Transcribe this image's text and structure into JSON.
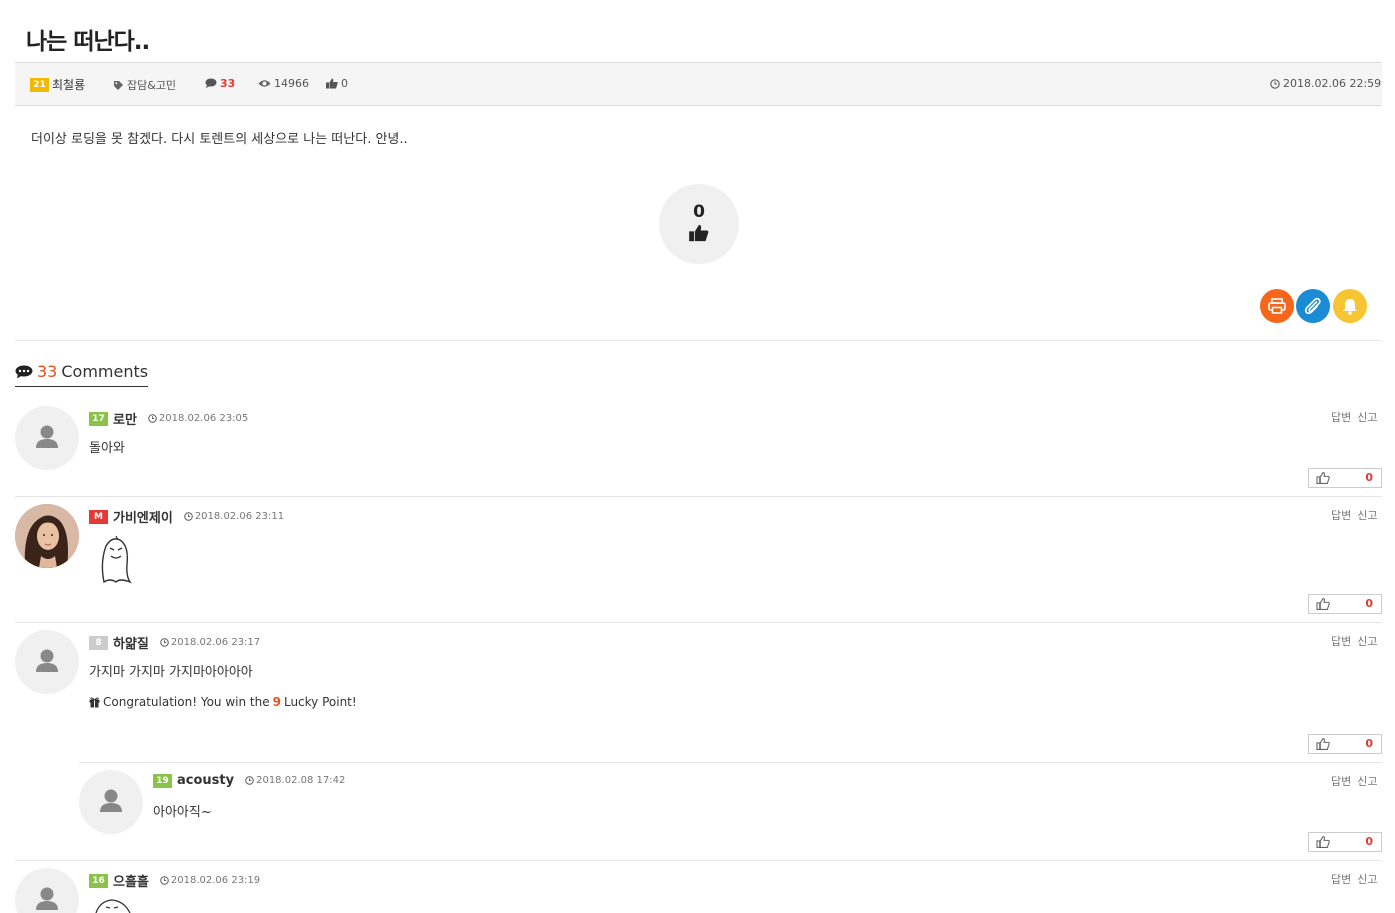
{
  "post": {
    "title": "나는 떠난다..",
    "author_level": "21",
    "author": "최철룡",
    "category": "잡담&고민",
    "comment_count": "33",
    "views": "14966",
    "likes": "0",
    "date": "2018.02.06 22:59",
    "body": "더이상 로딩을 못 참겠다. 다시 토렌트의 세상으로 나는 떠난다. 안녕..",
    "like_button_count": "0"
  },
  "comments_header": {
    "count": "33",
    "label": "Comments"
  },
  "comment_actions": {
    "reply": "답변",
    "report": "신고"
  },
  "comments": [
    {
      "level": "17",
      "level_color": "#8bc34a",
      "name": "로만",
      "time": "2018.02.06 23:05",
      "text": "돌아와",
      "votes": "0"
    },
    {
      "level": "M",
      "level_color": "#e53935",
      "name": "가비엔제이",
      "time": "2018.02.06 23:11",
      "text": "",
      "votes": "0"
    },
    {
      "level": "8",
      "level_color": "#cccccc",
      "name": "하얆질",
      "time": "2018.02.06 23:17",
      "text": "가지마 가지마 가지마아아아아",
      "lucky_prefix": "Congratulation! You win the",
      "lucky_points": "9",
      "lucky_suffix": "Lucky Point!",
      "votes": "0"
    },
    {
      "level": "19",
      "level_color": "#8bc34a",
      "name": "acousty",
      "time": "2018.02.08 17:42",
      "text": "아아아직~",
      "votes": "0"
    },
    {
      "level": "16",
      "level_color": "#8bc34a",
      "name": "으흘흘",
      "time": "2018.02.06 23:19",
      "text": "",
      "votes": ""
    }
  ]
}
